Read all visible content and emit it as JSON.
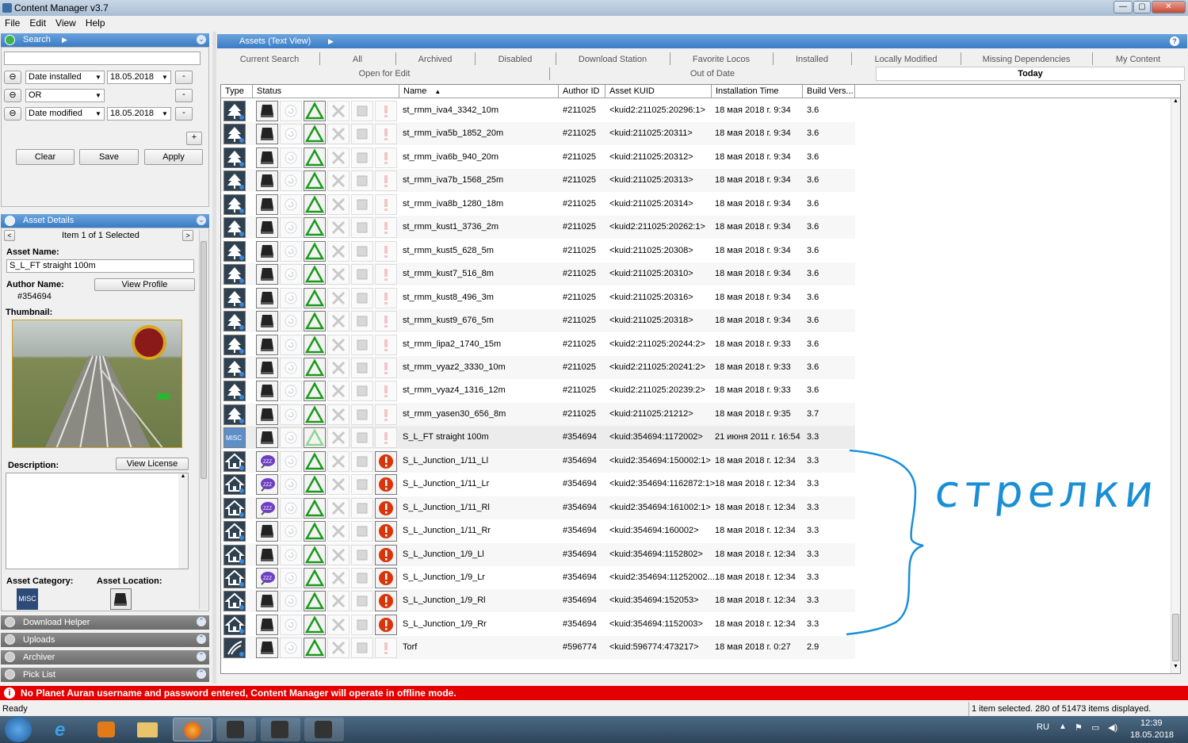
{
  "window": {
    "title": "Content Manager v3.7",
    "min": "—",
    "max": "▢",
    "close": "✕"
  },
  "menu": [
    "File",
    "Edit",
    "View",
    "Help"
  ],
  "search_panel": {
    "title": "Search",
    "filters": [
      {
        "field": "Date installed",
        "value": "18.05.2018"
      },
      {
        "field": "OR",
        "value": ""
      },
      {
        "field": "Date modified",
        "value": "18.05.2018"
      }
    ],
    "minus": "-",
    "plus": "+",
    "clear": "Clear",
    "save": "Save",
    "apply": "Apply"
  },
  "details": {
    "title": "Asset Details",
    "item_of": "Item 1 of 1 Selected",
    "asset_name_label": "Asset Name:",
    "asset_name": "S_L_FT straight 100m",
    "author_label": "Author Name:",
    "author": "#354694",
    "view_profile": "View Profile",
    "thumbnail_label": "Thumbnail:",
    "description_label": "Description:",
    "view_license": "View License",
    "category_label": "Asset Category:",
    "category": "MISC",
    "location_label": "Asset Location:"
  },
  "collapsed_panels": [
    "Download Helper",
    "Uploads",
    "Archiver",
    "Pick List"
  ],
  "assets_header": "Assets (Text View)",
  "tabs_row1": [
    "Current Search",
    "All",
    "Archived",
    "Disabled",
    "Download Station",
    "Favorite Locos",
    "Installed",
    "Locally Modified",
    "Missing Dependencies",
    "My Content"
  ],
  "tabs_row2": [
    "Open for Edit",
    "Out of Date",
    "Today"
  ],
  "columns": [
    "Type",
    "Status",
    "Name",
    "Author ID",
    "Asset KUID",
    "Installation Time",
    "Build Vers..."
  ],
  "rows": [
    {
      "type": "tree",
      "name": "st_rmm_iva4_3342_10m",
      "author": "#211025",
      "kuid": "<kuid2:211025:20296:1>",
      "time": "18 мая 2018 г. 9:34",
      "build": "3.6",
      "warn": false,
      "purple": false
    },
    {
      "type": "tree",
      "name": "st_rmm_iva5b_1852_20m",
      "author": "#211025",
      "kuid": "<kuid:211025:20311>",
      "time": "18 мая 2018 г. 9:34",
      "build": "3.6",
      "warn": false,
      "purple": false
    },
    {
      "type": "tree",
      "name": "st_rmm_iva6b_940_20m",
      "author": "#211025",
      "kuid": "<kuid:211025:20312>",
      "time": "18 мая 2018 г. 9:34",
      "build": "3.6",
      "warn": false,
      "purple": false
    },
    {
      "type": "tree",
      "name": "st_rmm_iva7b_1568_25m",
      "author": "#211025",
      "kuid": "<kuid:211025:20313>",
      "time": "18 мая 2018 г. 9:34",
      "build": "3.6",
      "warn": false,
      "purple": false
    },
    {
      "type": "tree",
      "name": "st_rmm_iva8b_1280_18m",
      "author": "#211025",
      "kuid": "<kuid:211025:20314>",
      "time": "18 мая 2018 г. 9:34",
      "build": "3.6",
      "warn": false,
      "purple": false
    },
    {
      "type": "tree",
      "name": "st_rmm_kust1_3736_2m",
      "author": "#211025",
      "kuid": "<kuid2:211025:20262:1>",
      "time": "18 мая 2018 г. 9:34",
      "build": "3.6",
      "warn": false,
      "purple": false
    },
    {
      "type": "tree",
      "name": "st_rmm_kust5_628_5m",
      "author": "#211025",
      "kuid": "<kuid:211025:20308>",
      "time": "18 мая 2018 г. 9:34",
      "build": "3.6",
      "warn": false,
      "purple": false
    },
    {
      "type": "tree",
      "name": "st_rmm_kust7_516_8m",
      "author": "#211025",
      "kuid": "<kuid:211025:20310>",
      "time": "18 мая 2018 г. 9:34",
      "build": "3.6",
      "warn": false,
      "purple": false
    },
    {
      "type": "tree",
      "name": "st_rmm_kust8_496_3m",
      "author": "#211025",
      "kuid": "<kuid:211025:20316>",
      "time": "18 мая 2018 г. 9:34",
      "build": "3.6",
      "warn": false,
      "purple": false
    },
    {
      "type": "tree",
      "name": "st_rmm_kust9_676_5m",
      "author": "#211025",
      "kuid": "<kuid:211025:20318>",
      "time": "18 мая 2018 г. 9:34",
      "build": "3.6",
      "warn": false,
      "purple": false
    },
    {
      "type": "tree",
      "name": "st_rmm_lipa2_1740_15m",
      "author": "#211025",
      "kuid": "<kuid2:211025:20244:2>",
      "time": "18 мая 2018 г. 9:33",
      "build": "3.6",
      "warn": false,
      "purple": false
    },
    {
      "type": "tree",
      "name": "st_rmm_vyaz2_3330_10m",
      "author": "#211025",
      "kuid": "<kuid2:211025:20241:2>",
      "time": "18 мая 2018 г. 9:33",
      "build": "3.6",
      "warn": false,
      "purple": false
    },
    {
      "type": "tree",
      "name": "st_rmm_vyaz4_1316_12m",
      "author": "#211025",
      "kuid": "<kuid2:211025:20239:2>",
      "time": "18 мая 2018 г. 9:33",
      "build": "3.6",
      "warn": false,
      "purple": false
    },
    {
      "type": "tree",
      "name": "st_rmm_yasen30_656_8m",
      "author": "#211025",
      "kuid": "<kuid:211025:21212>",
      "time": "18 мая 2018 г. 9:35",
      "build": "3.7",
      "warn": false,
      "purple": false
    },
    {
      "type": "misc",
      "name": "S_L_FT straight 100m",
      "author": "#354694",
      "kuid": "<kuid:354694:1172002>",
      "time": "21 июня 2011 г. 16:54",
      "build": "3.3",
      "warn": false,
      "purple": false
    },
    {
      "type": "house",
      "name": "S_L_Junction_1/11_Ll",
      "author": "#354694",
      "kuid": "<kuid2:354694:150002:1>",
      "time": "18 мая 2018 г. 12:34",
      "build": "3.3",
      "warn": true,
      "purple": true
    },
    {
      "type": "house",
      "name": "S_L_Junction_1/11_Lr",
      "author": "#354694",
      "kuid": "<kuid2:354694:1162872:1>",
      "time": "18 мая 2018 г. 12:34",
      "build": "3.3",
      "warn": true,
      "purple": true
    },
    {
      "type": "house",
      "name": "S_L_Junction_1/11_Rl",
      "author": "#354694",
      "kuid": "<kuid2:354694:161002:1>",
      "time": "18 мая 2018 г. 12:34",
      "build": "3.3",
      "warn": true,
      "purple": true
    },
    {
      "type": "house",
      "name": "S_L_Junction_1/11_Rr",
      "author": "#354694",
      "kuid": "<kuid:354694:160002>",
      "time": "18 мая 2018 г. 12:34",
      "build": "3.3",
      "warn": true,
      "purple": false
    },
    {
      "type": "house",
      "name": "S_L_Junction_1/9_Ll",
      "author": "#354694",
      "kuid": "<kuid:354694:1152802>",
      "time": "18 мая 2018 г. 12:34",
      "build": "3.3",
      "warn": true,
      "purple": false
    },
    {
      "type": "house",
      "name": "S_L_Junction_1/9_Lr",
      "author": "#354694",
      "kuid": "<kuid2:354694:11252002...",
      "time": "18 мая 2018 г. 12:34",
      "build": "3.3",
      "warn": true,
      "purple": true
    },
    {
      "type": "house",
      "name": "S_L_Junction_1/9_Rl",
      "author": "#354694",
      "kuid": "<kuid:354694:152053>",
      "time": "18 мая 2018 г. 12:34",
      "build": "3.3",
      "warn": true,
      "purple": false
    },
    {
      "type": "house",
      "name": "S_L_Junction_1/9_Rr",
      "author": "#354694",
      "kuid": "<kuid:354694:1152003>",
      "time": "18 мая 2018 г. 12:34",
      "build": "3.3",
      "warn": true,
      "purple": false
    },
    {
      "type": "grass",
      "name": "Torf",
      "author": "#596774",
      "kuid": "<kuid:596774:473217>",
      "time": "18 мая 2018 г. 0:27",
      "build": "2.9",
      "warn": false,
      "purple": false
    }
  ],
  "annotation": "стрелки",
  "offline_message": "No Planet Auran username and password entered, Content Manager will operate in offline mode.",
  "ready": "Ready",
  "selection_status": "1 item selected. 280 of 51473 items displayed.",
  "tray": {
    "lang": "RU",
    "time": "12:39",
    "date": "18.05.2018"
  },
  "colors": {
    "accent": "#3a7cc5",
    "error_bar": "#e50000",
    "annotation": "#1a8fd6",
    "warn_icon": "#d9350b",
    "ok_triangle": "#1a9a1a"
  }
}
